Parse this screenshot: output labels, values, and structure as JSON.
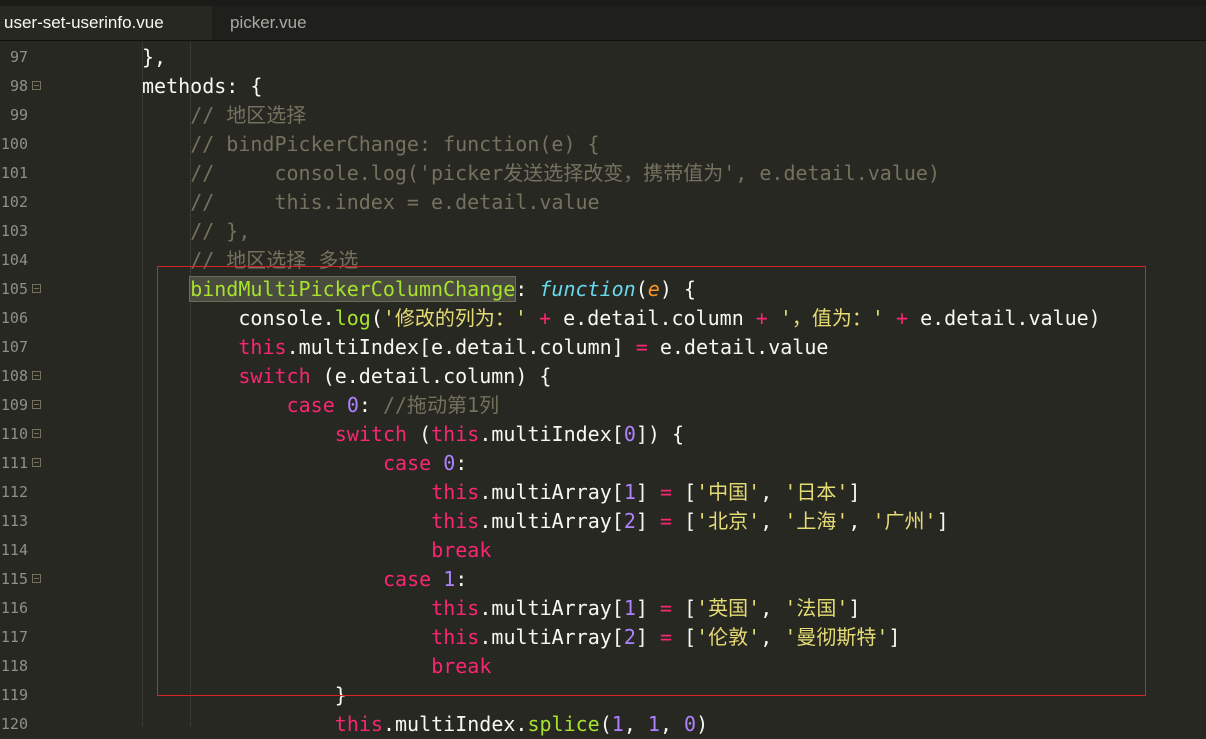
{
  "tabs": [
    {
      "label": "user-set-userinfo.vue",
      "dirty_marker": "f",
      "active": true
    },
    {
      "label": "picker.vue",
      "active": false
    }
  ],
  "editor": {
    "lines": [
      {
        "num": "97",
        "fold": false,
        "indent": 0,
        "tokens": [
          [
            "p",
            "},"
          ]
        ]
      },
      {
        "num": "98",
        "fold": true,
        "indent": 0,
        "tokens": [
          [
            "p",
            "methods: {"
          ]
        ]
      },
      {
        "num": "99",
        "fold": false,
        "indent": 4,
        "tokens": [
          [
            "c",
            "// 地区选择"
          ]
        ]
      },
      {
        "num": "100",
        "fold": false,
        "indent": 4,
        "tokens": [
          [
            "c",
            "// bindPickerChange: function(e) {"
          ]
        ]
      },
      {
        "num": "101",
        "fold": false,
        "indent": 4,
        "tokens": [
          [
            "c",
            "//     console.log('picker发送选择改变，携带值为', e.detail.value)"
          ]
        ]
      },
      {
        "num": "102",
        "fold": false,
        "indent": 4,
        "tokens": [
          [
            "c",
            "//     this.index = e.detail.value"
          ]
        ]
      },
      {
        "num": "103",
        "fold": false,
        "indent": 4,
        "tokens": [
          [
            "c",
            "// },"
          ]
        ]
      },
      {
        "num": "104",
        "fold": false,
        "indent": 4,
        "tokens": [
          [
            "c",
            "// 地区选择 多选"
          ]
        ]
      },
      {
        "num": "105",
        "fold": true,
        "indent": 4,
        "tokens": [
          [
            "fhl",
            "bindMultiPickerColumnChange"
          ],
          [
            "p",
            ": "
          ],
          [
            "i",
            "function"
          ],
          [
            "p",
            "("
          ],
          [
            "pa",
            "e"
          ],
          [
            "p",
            ") {"
          ]
        ]
      },
      {
        "num": "106",
        "fold": false,
        "indent": 8,
        "tokens": [
          [
            "p",
            "console."
          ],
          [
            "f",
            "log"
          ],
          [
            "p",
            "("
          ],
          [
            "s",
            "'修改的列为：'"
          ],
          [
            "p",
            " "
          ],
          [
            "k",
            "+"
          ],
          [
            "p",
            " e.detail.column "
          ],
          [
            "k",
            "+"
          ],
          [
            "p",
            " "
          ],
          [
            "s",
            "'，值为：'"
          ],
          [
            "p",
            " "
          ],
          [
            "k",
            "+"
          ],
          [
            "p",
            " e.detail.value)"
          ]
        ]
      },
      {
        "num": "107",
        "fold": false,
        "indent": 8,
        "tokens": [
          [
            "k",
            "this"
          ],
          [
            "p",
            ".multiIndex[e.detail.column] "
          ],
          [
            "k",
            "="
          ],
          [
            "p",
            " e.detail.value"
          ]
        ]
      },
      {
        "num": "108",
        "fold": true,
        "indent": 8,
        "tokens": [
          [
            "k",
            "switch"
          ],
          [
            "p",
            " (e.detail.column) {"
          ]
        ]
      },
      {
        "num": "109",
        "fold": true,
        "indent": 12,
        "tokens": [
          [
            "k",
            "case"
          ],
          [
            "p",
            " "
          ],
          [
            "n",
            "0"
          ],
          [
            "p",
            ": "
          ],
          [
            "c",
            "//拖动第1列"
          ]
        ]
      },
      {
        "num": "110",
        "fold": true,
        "indent": 16,
        "tokens": [
          [
            "k",
            "switch"
          ],
          [
            "p",
            " ("
          ],
          [
            "k",
            "this"
          ],
          [
            "p",
            ".multiIndex["
          ],
          [
            "n",
            "0"
          ],
          [
            "p",
            "]) {"
          ]
        ]
      },
      {
        "num": "111",
        "fold": true,
        "indent": 20,
        "tokens": [
          [
            "k",
            "case"
          ],
          [
            "p",
            " "
          ],
          [
            "n",
            "0"
          ],
          [
            "p",
            ":"
          ]
        ]
      },
      {
        "num": "112",
        "fold": false,
        "indent": 24,
        "tokens": [
          [
            "k",
            "this"
          ],
          [
            "p",
            ".multiArray["
          ],
          [
            "n",
            "1"
          ],
          [
            "p",
            "] "
          ],
          [
            "k",
            "="
          ],
          [
            "p",
            " ["
          ],
          [
            "s",
            "'中国'"
          ],
          [
            "p",
            ", "
          ],
          [
            "s",
            "'日本'"
          ],
          [
            "p",
            "]"
          ]
        ]
      },
      {
        "num": "113",
        "fold": false,
        "indent": 24,
        "tokens": [
          [
            "k",
            "this"
          ],
          [
            "p",
            ".multiArray["
          ],
          [
            "n",
            "2"
          ],
          [
            "p",
            "] "
          ],
          [
            "k",
            "="
          ],
          [
            "p",
            " ["
          ],
          [
            "s",
            "'北京'"
          ],
          [
            "p",
            ", "
          ],
          [
            "s",
            "'上海'"
          ],
          [
            "p",
            ", "
          ],
          [
            "s",
            "'广州'"
          ],
          [
            "p",
            "]"
          ]
        ]
      },
      {
        "num": "114",
        "fold": false,
        "indent": 24,
        "tokens": [
          [
            "k",
            "break"
          ]
        ]
      },
      {
        "num": "115",
        "fold": true,
        "indent": 20,
        "tokens": [
          [
            "k",
            "case"
          ],
          [
            "p",
            " "
          ],
          [
            "n",
            "1"
          ],
          [
            "p",
            ":"
          ]
        ]
      },
      {
        "num": "116",
        "fold": false,
        "indent": 24,
        "tokens": [
          [
            "k",
            "this"
          ],
          [
            "p",
            ".multiArray["
          ],
          [
            "n",
            "1"
          ],
          [
            "p",
            "] "
          ],
          [
            "k",
            "="
          ],
          [
            "p",
            " ["
          ],
          [
            "s",
            "'英国'"
          ],
          [
            "p",
            ", "
          ],
          [
            "s",
            "'法国'"
          ],
          [
            "p",
            "]"
          ]
        ]
      },
      {
        "num": "117",
        "fold": false,
        "indent": 24,
        "tokens": [
          [
            "k",
            "this"
          ],
          [
            "p",
            ".multiArray["
          ],
          [
            "n",
            "2"
          ],
          [
            "p",
            "] "
          ],
          [
            "k",
            "="
          ],
          [
            "p",
            " ["
          ],
          [
            "s",
            "'伦敦'"
          ],
          [
            "p",
            ", "
          ],
          [
            "s",
            "'曼彻斯特'"
          ],
          [
            "p",
            "]"
          ]
        ]
      },
      {
        "num": "118",
        "fold": false,
        "indent": 24,
        "tokens": [
          [
            "k",
            "break"
          ]
        ]
      },
      {
        "num": "119",
        "fold": false,
        "indent": 16,
        "tokens": [
          [
            "p",
            "}"
          ]
        ]
      },
      {
        "num": "120",
        "fold": false,
        "indent": 16,
        "tokens": [
          [
            "k",
            "this"
          ],
          [
            "p",
            ".multiIndex."
          ],
          [
            "f",
            "splice"
          ],
          [
            "p",
            "("
          ],
          [
            "n",
            "1"
          ],
          [
            "p",
            ", "
          ],
          [
            "n",
            "1"
          ],
          [
            "p",
            ", "
          ],
          [
            "n",
            "0"
          ],
          [
            "p",
            ")"
          ]
        ]
      }
    ]
  },
  "colors": {
    "background": "#272822",
    "comment": "#75715e",
    "keyword": "#f92672",
    "string": "#e6db74",
    "number": "#ae81ff",
    "function": "#a6e22e",
    "highlight_box": "#d62424"
  }
}
